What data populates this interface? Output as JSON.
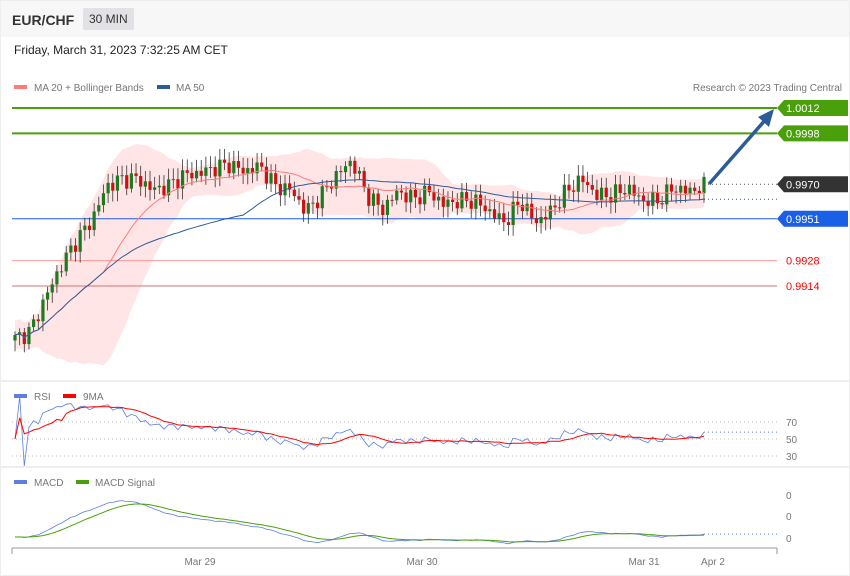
{
  "header": {
    "symbol": "EUR/CHF",
    "timeframe": "30 MIN",
    "datetime": "Friday, March 31, 2023 7:32:25 AM CET"
  },
  "legend": {
    "ma20": "MA 20 + Bollinger Bands",
    "ma50": "MA 50",
    "copyright": "Research © 2023 Trading Central",
    "rsi": "RSI",
    "rsi_ma": "9MA",
    "macd": "MACD",
    "macd_signal": "MACD Signal"
  },
  "colors": {
    "ma20": "#ff7b7b",
    "ma50": "#2c5b9a",
    "bands": "#ffdede",
    "resistance": "#4aa00a",
    "support_blue": "#1a5fe8",
    "support_red": "#ff0000",
    "last": "#333333",
    "rsi": "#5c7fe0",
    "rsi_ma": "#ff0000",
    "macd": "#5c7fe0",
    "signal": "#4aa00a"
  },
  "levels": [
    {
      "value": "1.0012",
      "type": "resistance"
    },
    {
      "value": "0.9998",
      "type": "resistance"
    },
    {
      "value": "0.9970",
      "type": "last"
    },
    {
      "value": "0.9951",
      "type": "pivot"
    },
    {
      "value": "0.9928",
      "type": "support"
    },
    {
      "value": "0.9914",
      "type": "support"
    }
  ],
  "rsi_levels": [
    "70",
    "50",
    "30"
  ],
  "macd_levels": [
    "0",
    "0",
    "0"
  ],
  "x_labels": [
    "Mar 29",
    "Mar 30",
    "Mar 31",
    "Apr 2"
  ],
  "chart_data": {
    "type": "candlestick",
    "price_path": [
      0.9885,
      0.9889,
      0.9908,
      0.9925,
      0.9939,
      0.995,
      0.9969,
      0.9973,
      0.9973,
      0.9967,
      0.9969,
      0.9975,
      0.9976,
      0.9979,
      0.9981,
      0.9977,
      0.998,
      0.9969,
      0.9967,
      0.9955,
      0.9964,
      0.9975,
      0.9983,
      0.9964,
      0.9956,
      0.9966,
      0.9962,
      0.9966,
      0.9959,
      0.9961,
      0.9961,
      0.9955,
      0.9949,
      0.9961,
      0.9949,
      0.9955,
      0.9966,
      0.9973,
      0.9964,
      0.9964,
      0.9968,
      0.9961,
      0.9961,
      0.9968,
      0.9966,
      0.9969
    ],
    "candles": 149,
    "ylim": [
      0.9869,
      1.0025
    ]
  }
}
